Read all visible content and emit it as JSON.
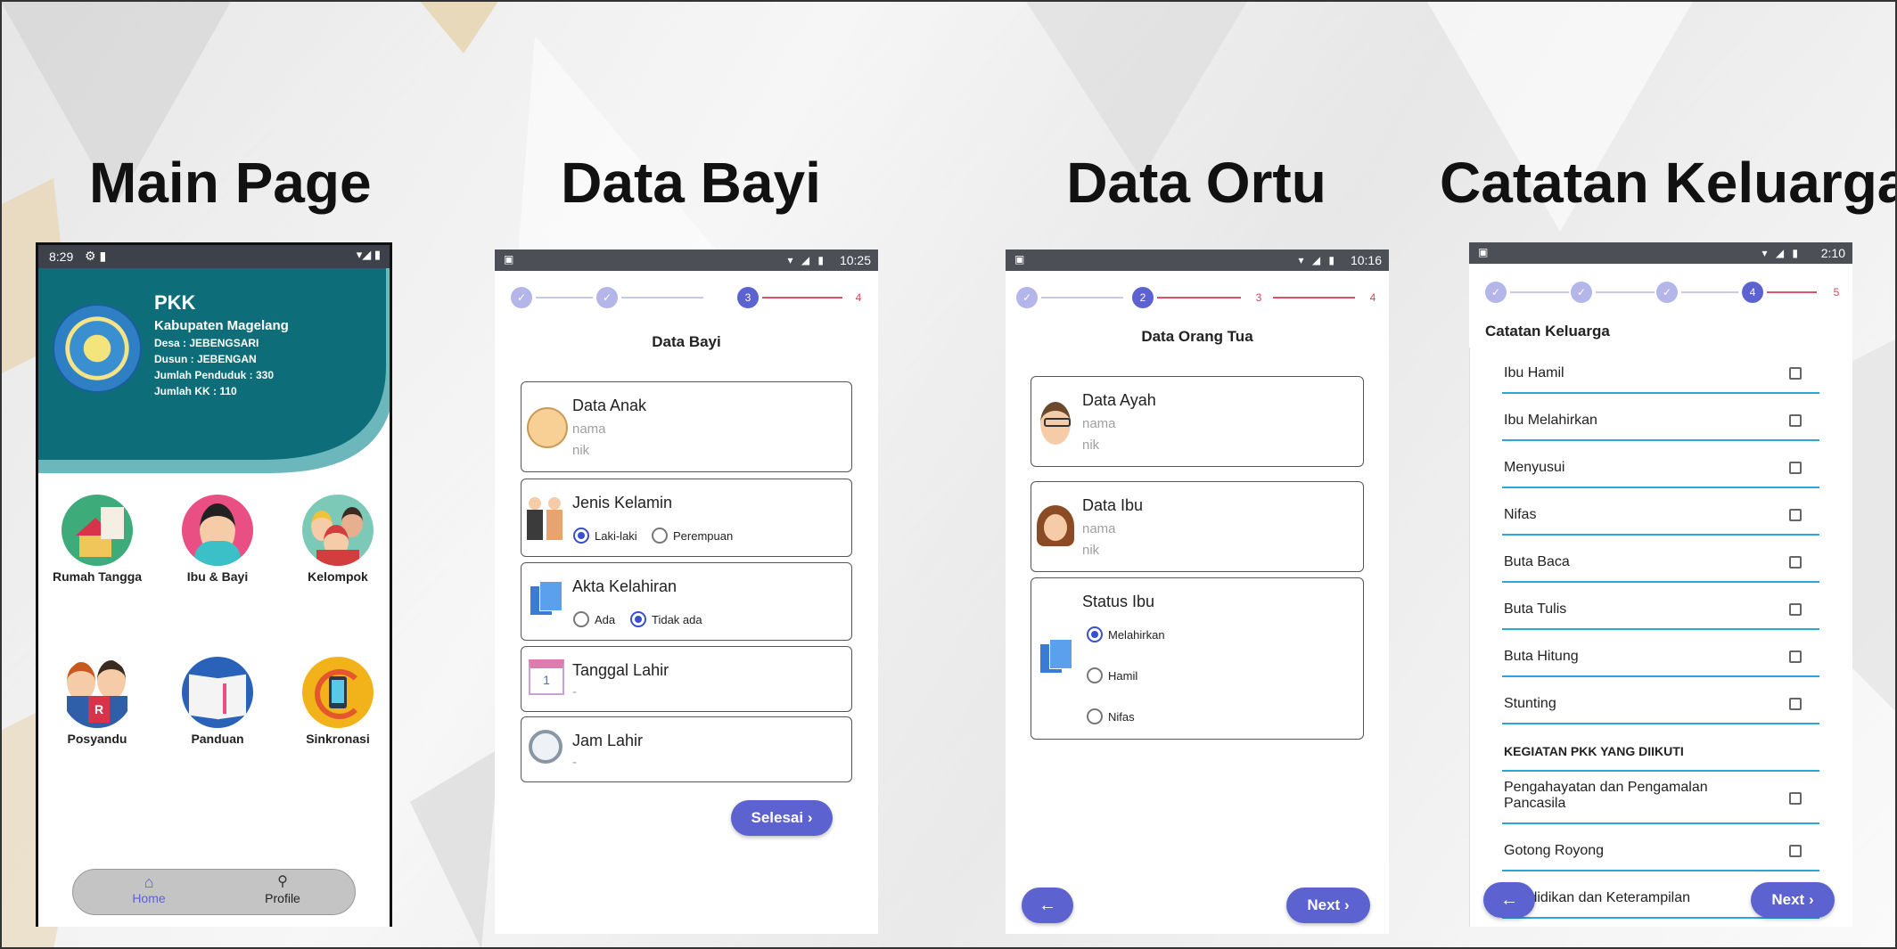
{
  "titles": {
    "main": "Main Page",
    "bayi": "Data Bayi",
    "ortu": "Data Ortu",
    "catatan": "Catatan Keluarga"
  },
  "main_page": {
    "status_time": "8:29",
    "org": "PKK",
    "kabupaten": "Kabupaten Magelang",
    "desa": "Desa : JEBENGSARI",
    "dusun": "Dusun : JEBENGAN",
    "penduduk": "Jumlah Penduduk : 330",
    "kk": "Jumlah KK : 110",
    "menu": [
      {
        "label": "Rumah Tangga",
        "icon": "house-icon"
      },
      {
        "label": "Ibu & Bayi",
        "icon": "mother-baby-icon"
      },
      {
        "label": "Kelompok",
        "icon": "group-icon"
      },
      {
        "label": "Posyandu",
        "icon": "posyandu-icon"
      },
      {
        "label": "Panduan",
        "icon": "book-icon"
      },
      {
        "label": "Sinkronasi",
        "icon": "sync-icon"
      }
    ],
    "nav": {
      "home": "Home",
      "profile": "Profile"
    },
    "colors": {
      "header": "#0d6d79",
      "accent": "#5c62d0"
    }
  },
  "bayi_page": {
    "status_time": "10:25",
    "steps": [
      "✓",
      "✓",
      "3",
      "4"
    ],
    "title": "Data Bayi",
    "anak": {
      "title": "Data Anak",
      "nama": "nama",
      "nik": "nik"
    },
    "kelamin": {
      "title": "Jenis Kelamin",
      "opt1": "Laki-laki",
      "opt2": "Perempuan",
      "selected": "Laki-laki"
    },
    "akta": {
      "title": "Akta Kelahiran",
      "opt1": "Ada",
      "opt2": "Tidak ada",
      "selected": "Tidak ada"
    },
    "tanggal": {
      "title": "Tanggal Lahir",
      "value": "-"
    },
    "jam": {
      "title": "Jam Lahir",
      "value": "-"
    },
    "button": "Selesai"
  },
  "ortu_page": {
    "status_time": "10:16",
    "steps": [
      "✓",
      "2",
      "3",
      "4"
    ],
    "title": "Data Orang Tua",
    "ayah": {
      "title": "Data Ayah",
      "nama": "nama",
      "nik": "nik"
    },
    "ibu": {
      "title": "Data Ibu",
      "nama": "nama",
      "nik": "nik"
    },
    "status": {
      "title": "Status Ibu",
      "opt1": "Melahirkan",
      "opt2": "Hamil",
      "opt3": "Nifas",
      "selected": "Melahirkan"
    },
    "next": "Next",
    "back": "←"
  },
  "catatan_page": {
    "status_time": "2:10",
    "steps": [
      "✓",
      "✓",
      "✓",
      "4",
      "5"
    ],
    "title": "Catatan Keluarga",
    "items": [
      "Ibu Hamil",
      "Ibu Melahirkan",
      "Menyusui",
      "Nifas",
      "Buta Baca",
      "Buta Tulis",
      "Buta Hitung",
      "Stunting"
    ],
    "section": "KEGIATAN PKK YANG DIIKUTI",
    "kegiatan": [
      "Pengahayatan dan Pengamalan Pancasila",
      "Gotong Royong",
      "Pendidikan dan Keterampilan"
    ],
    "next": "Next",
    "back": "←"
  }
}
